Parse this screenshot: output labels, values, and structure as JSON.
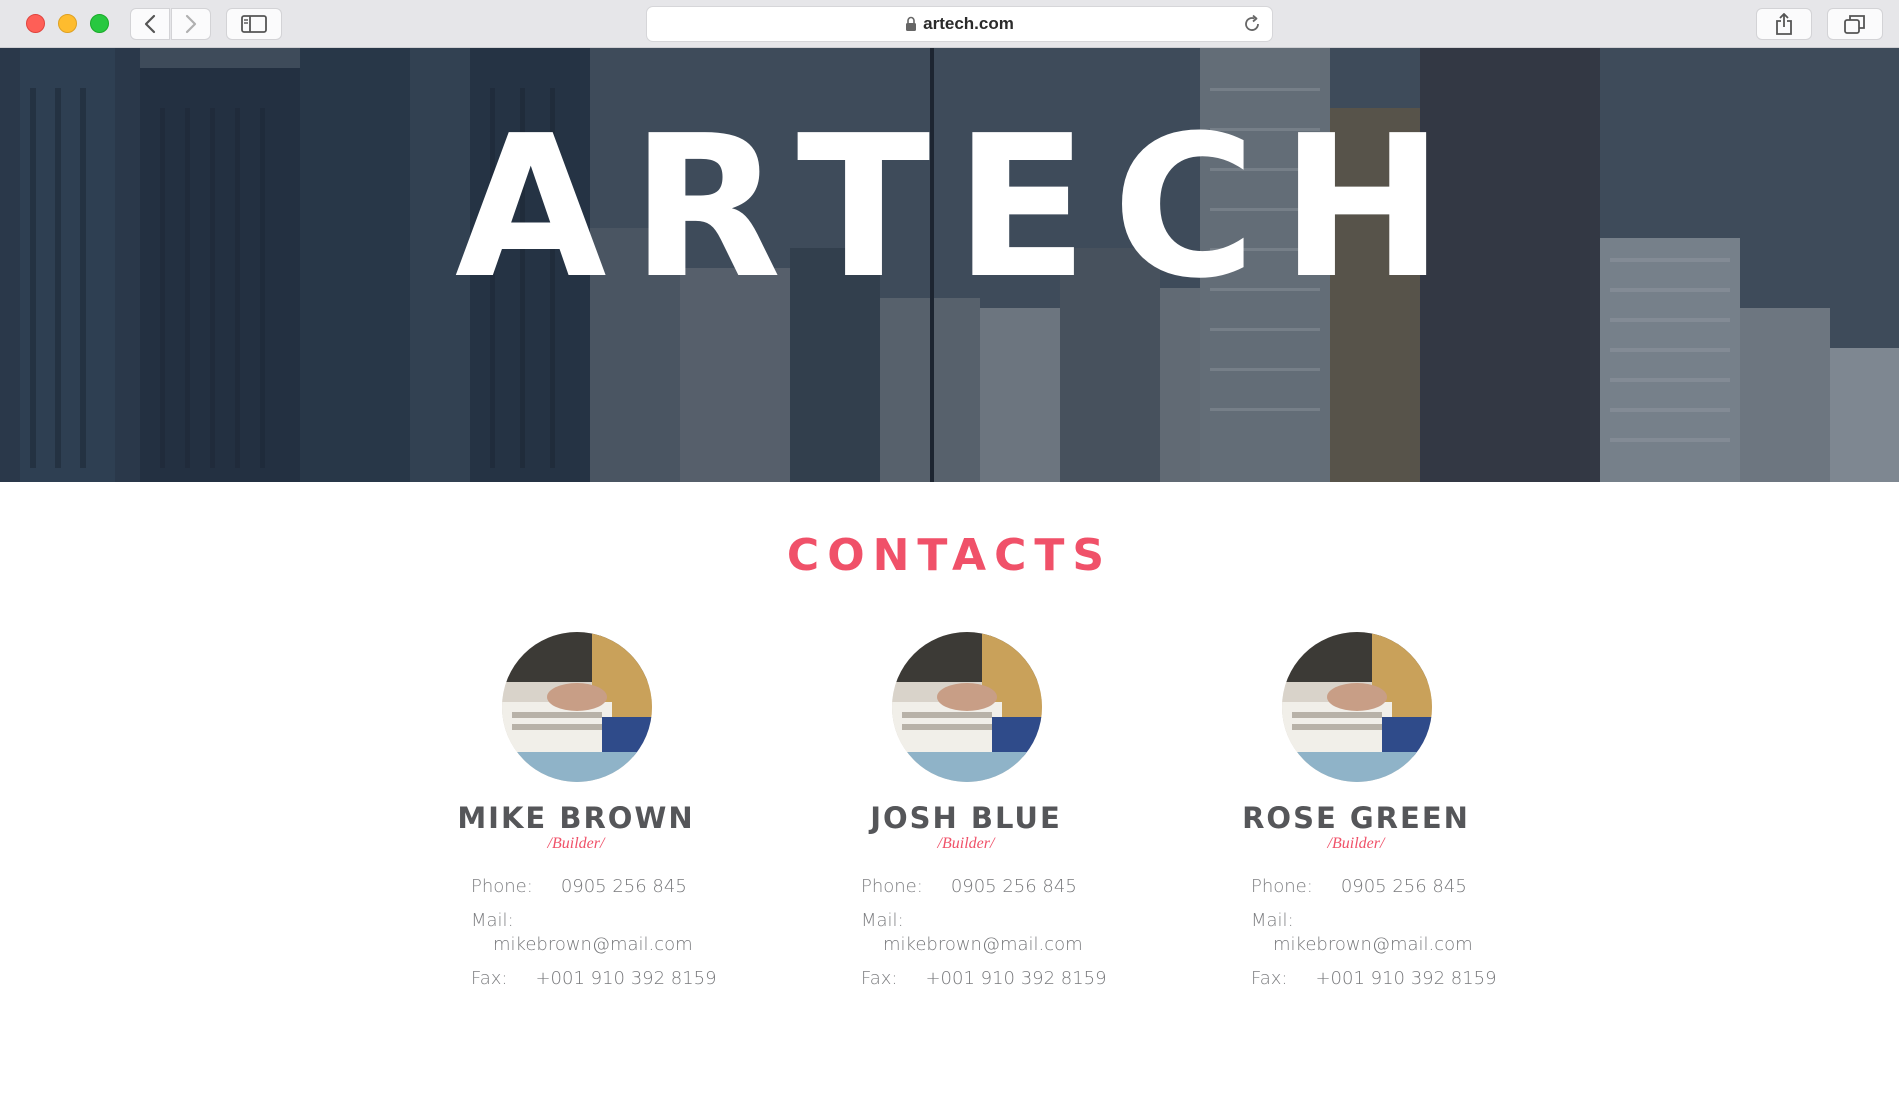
{
  "browser": {
    "url": "artech.com",
    "icons": {
      "back": "chevron-left-icon",
      "forward": "chevron-right-icon",
      "sidebar": "sidebar-icon",
      "lock": "lock-icon",
      "reload": "reload-icon",
      "share": "share-icon",
      "tabs": "tabs-icon"
    }
  },
  "hero": {
    "title": "ARTECH"
  },
  "contacts": {
    "title": "CONTACTS",
    "accent_color": "#f05169",
    "people": [
      {
        "name": "MIKE BROWN",
        "role": "/Builder/",
        "phone_label": "Phone:",
        "phone": "0905 256 845",
        "mail_label": "Mail:",
        "mail": "mikebrown@mail.com",
        "fax_label": "Fax:",
        "fax": "+001 910 392 8159"
      },
      {
        "name": "JOSH BLUE",
        "role": "/Builder/",
        "phone_label": "Phone:",
        "phone": "0905 256 845",
        "mail_label": "Mail:",
        "mail": "mikebrown@mail.com",
        "fax_label": "Fax:",
        "fax": "+001 910 392 8159"
      },
      {
        "name": "ROSE GREEN",
        "role": "/Builder/",
        "phone_label": "Phone:",
        "phone": "0905 256 845",
        "mail_label": "Mail:",
        "mail": "mikebrown@mail.com",
        "fax_label": "Fax:",
        "fax": "+001 910 392 8159"
      }
    ]
  }
}
